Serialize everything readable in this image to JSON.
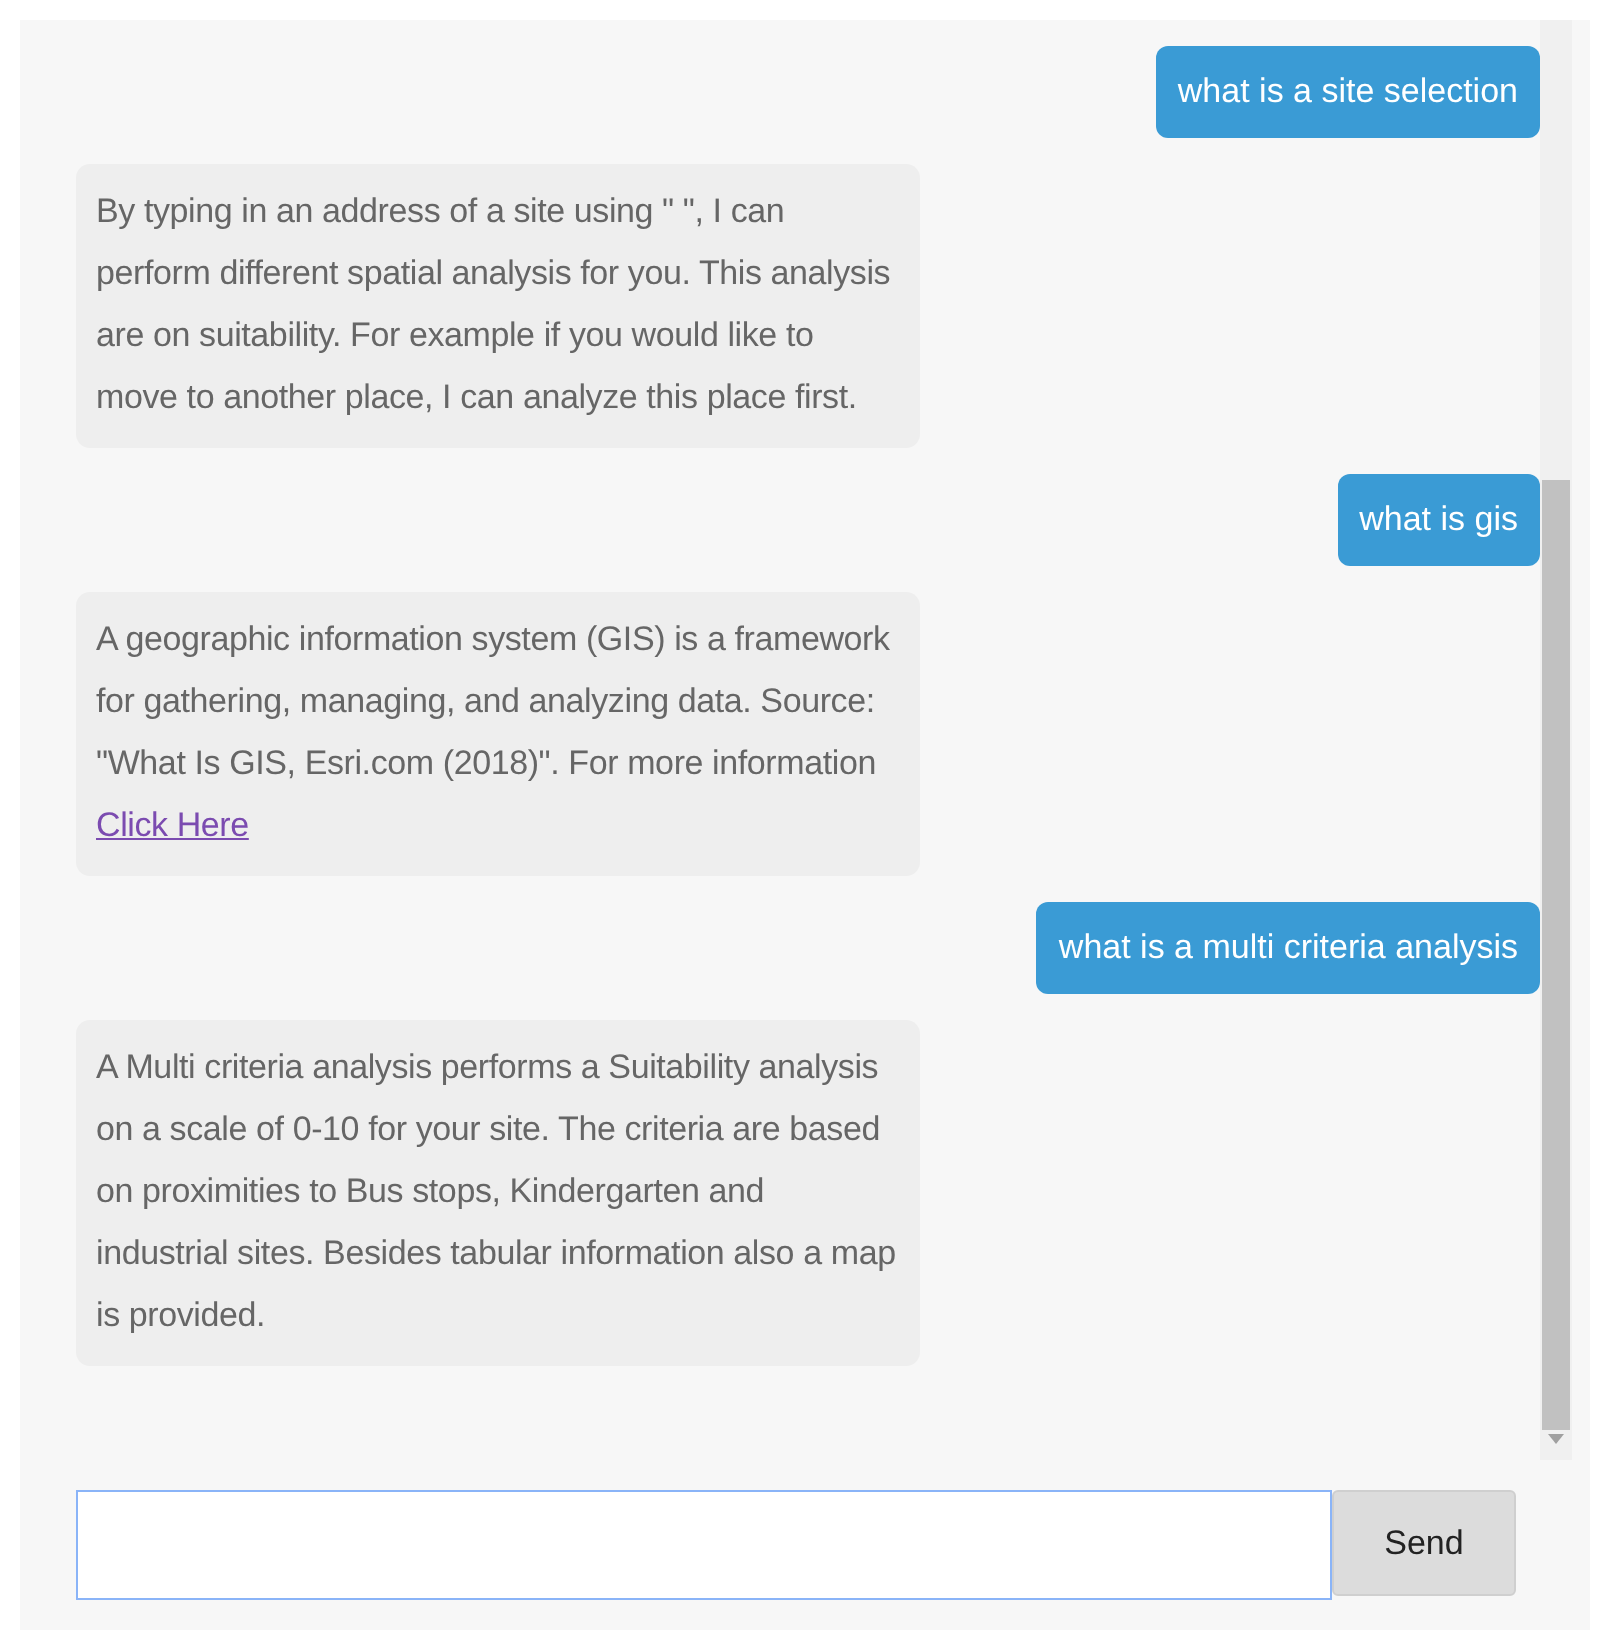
{
  "messages": [
    {
      "kind": "user",
      "text": "what is a site selection"
    },
    {
      "kind": "bot",
      "text": "By typing in an address of a site using \" \", I can perform different spatial analysis for you. This analysis are on suitability. For example if you would like to move to another place, I can analyze this place first."
    },
    {
      "kind": "user",
      "text": "what is gis"
    },
    {
      "kind": "bot",
      "text": "A geographic information system (GIS) is a framework for gathering, managing, and analyzing data. Source: \"What Is GIS, Esri.com (2018)\". For more information",
      "link": "Click Here"
    },
    {
      "kind": "user",
      "text": "what is a multi criteria analysis"
    },
    {
      "kind": "bot",
      "text": "A Multi criteria analysis performs a Suitability analysis on a scale of 0-10 for your site. The criteria are based on proximities to Bus stops, Kindergarten and industrial sites. Besides tabular information also a map is provided."
    }
  ],
  "send_button": "Send"
}
